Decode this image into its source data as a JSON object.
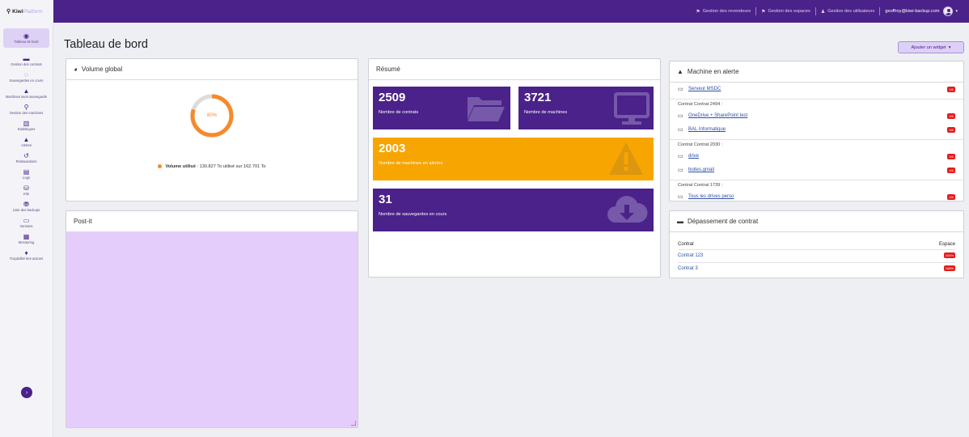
{
  "app": {
    "logo_text": "Kiwi",
    "logo_accent": "Platform"
  },
  "topnav": {
    "resellers": "Gestion des revendeurs",
    "spaces": "Gestion des espaces",
    "users": "Gestion des utilisateurs",
    "user_email": "geoffroy@kiwi-backup.com"
  },
  "sidebar": {
    "items": [
      {
        "label": "Tableau de bord",
        "icon": "dashboard-icon",
        "glyph": "◉"
      },
      {
        "label": "Gestion des contrats",
        "icon": "folder-icon",
        "glyph": "▬"
      },
      {
        "label": "Sauvegardes en cours",
        "icon": "spinner-icon",
        "glyph": "◌"
      },
      {
        "label": "Machines sans sauvegarde",
        "icon": "warning-icon",
        "glyph": "▲"
      },
      {
        "label": "Gestion des machines",
        "icon": "search-icon",
        "glyph": "⚲"
      },
      {
        "label": "Statistiques",
        "icon": "bar-chart-icon",
        "glyph": "▥"
      },
      {
        "label": "Alertes",
        "icon": "alert-icon",
        "glyph": "▲"
      },
      {
        "label": "Restaurations",
        "icon": "history-icon",
        "glyph": "↺"
      },
      {
        "label": "Logs",
        "icon": "logs-chart-icon",
        "glyph": "▤"
      },
      {
        "label": "Kits",
        "icon": "drive-icon",
        "glyph": "⛁"
      },
      {
        "label": "Liste des backups",
        "icon": "database-icon",
        "glyph": "⛃"
      },
      {
        "label": "Versions",
        "icon": "monitor-icon",
        "glyph": "▭"
      },
      {
        "label": "Monitoring",
        "icon": "monitoring-icon",
        "glyph": "▦"
      },
      {
        "label": "Traçabilité des actions",
        "icon": "diamond-icon",
        "glyph": "♦"
      }
    ]
  },
  "main": {
    "title": "Tableau de bord",
    "add_widget": "Ajouter un widget"
  },
  "volume": {
    "title": "Volume global",
    "percent": 0.8,
    "percent_label": "80%",
    "legend_bold": "Volume utilisé",
    "legend_text": ": 130.827 To utilisé sur 162.701 To",
    "color": "#f58a2d"
  },
  "postit": {
    "title": "Post-it",
    "color": "#e5cdfb"
  },
  "resume": {
    "title": "Résumé",
    "tiles": [
      {
        "value": "2509",
        "label": "Nombre de contrats",
        "icon": "folder-open-icon",
        "color": "#4a2289"
      },
      {
        "value": "3721",
        "label": "Nombre de machines",
        "icon": "monitor-icon",
        "color": "#4a2289"
      },
      {
        "value": "2003",
        "label": "Nombre de machines en alertes",
        "icon": "warning-icon",
        "color": "#f7a500"
      },
      {
        "value": "31",
        "label": "Nombre de sauvegardes en cours",
        "icon": "cloud-download-icon",
        "color": "#4a2289"
      }
    ]
  },
  "alerts": {
    "title": "Machine en alerte",
    "top_item": {
      "name": "Serveur MSDC",
      "badge": "1/6"
    },
    "groups": [
      {
        "label": "Contrat Contrat 2494 :",
        "items": [
          {
            "name": "OneDrive + SharePoint test",
            "badge": "1/6"
          },
          {
            "name": "BAL Informatique",
            "badge": "1/6"
          }
        ]
      },
      {
        "label": "Contrat Contrat 2030 :",
        "items": [
          {
            "name": "drive",
            "badge": "1/6"
          },
          {
            "name": "boites.gmail",
            "badge": "1/6"
          }
        ]
      },
      {
        "label": "Contrat Contrat 1739 :",
        "items": [
          {
            "name": "Tous les drives perso",
            "badge": "1/6"
          }
        ]
      }
    ],
    "badge_color": "#e21b1b"
  },
  "depassement": {
    "title": "Dépassement de contrat",
    "col_contract": "Contrat",
    "col_space": "Espace",
    "rows": [
      {
        "name": "Contrat 123",
        "badge": "104%"
      },
      {
        "name": "Contrat 3",
        "badge": "108%"
      }
    ]
  }
}
